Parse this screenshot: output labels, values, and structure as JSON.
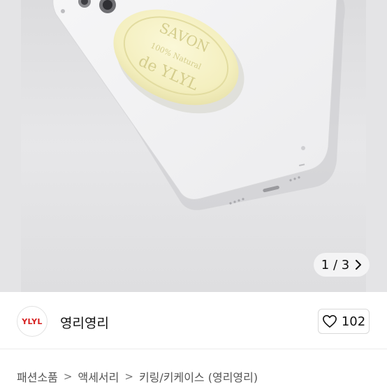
{
  "gallery": {
    "pager_text": "1 / 3",
    "pager_next_icon": "chevron-right-icon",
    "product_text": {
      "line1": "SAVON",
      "line2": "100% Natural",
      "line3": "de YLYL"
    }
  },
  "seller": {
    "avatar_text": "YLYL",
    "name": "영리영리",
    "like_icon": "heart-outline-icon",
    "like_count": "102"
  },
  "breadcrumb": {
    "items": [
      "패션소품",
      "액세서리",
      "키링/키케이스 (영리영리)"
    ]
  },
  "colors": {
    "accent_red": "#d62020",
    "background_gray": "#e4e4e6"
  }
}
